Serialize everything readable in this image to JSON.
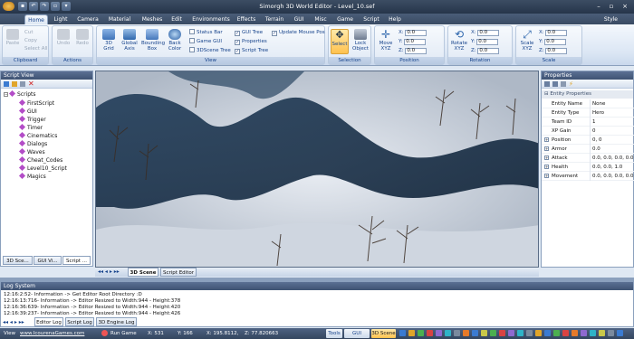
{
  "window": {
    "title": "Simorgh 3D World Editor - Level_10.sef",
    "style_label": "Style"
  },
  "tabs": [
    "Home",
    "Light",
    "Camera",
    "Material",
    "Meshes",
    "Edit",
    "Environments",
    "Effects",
    "Terrain",
    "GUI",
    "Misc",
    "Game",
    "Script",
    "Help"
  ],
  "ribbon": {
    "clipboard": {
      "label": "Clipboard",
      "paste": "Paste",
      "cut": "Cut",
      "copy": "Copy",
      "select_all": "Select All"
    },
    "actions": {
      "label": "Actions",
      "undo": "Undo",
      "redo": "Redo"
    },
    "view": {
      "label": "View",
      "grid": "3D Grid",
      "global_axis": "Global Axis",
      "bounding_box": "Bounding Box",
      "back_color": "Back Color",
      "checks": [
        {
          "label": "Status Bar",
          "checked": false
        },
        {
          "label": "Game GUI",
          "checked": false
        },
        {
          "label": "3DScene Tree",
          "checked": false
        },
        {
          "label": "GUI Tree",
          "checked": true
        },
        {
          "label": "Properties",
          "checked": true
        },
        {
          "label": "Script Tree",
          "checked": true
        },
        {
          "label": "Update Mouse Pos",
          "checked": true
        }
      ]
    },
    "selection": {
      "label": "Selection",
      "select": "Select",
      "lock_object": "Lock Object"
    },
    "position": {
      "label": "Position",
      "move": "Move XYZ",
      "x": "0.0",
      "y": "0.0",
      "z": "0.0"
    },
    "rotation": {
      "label": "Rotation",
      "rotate": "Rotate XYZ",
      "x": "0.0",
      "y": "0.0",
      "z": "0.0"
    },
    "scale": {
      "label": "Scale",
      "scale": "Scale XYZ",
      "x": "0.0",
      "y": "0.0",
      "z": "0.0"
    }
  },
  "script_view": {
    "title": "Script View",
    "root": "Scripts",
    "items": [
      "FirstScript",
      "GUI",
      "Trigger",
      "Timer",
      "Cinematics",
      "Dialogs",
      "Waves",
      "Cheat_Codes",
      "Level10_Script",
      "Magics"
    ],
    "bottom_tabs": [
      "3D Sce...",
      "GUI Vi...",
      "Script ..."
    ]
  },
  "viewport": {
    "tabs": [
      "3D Scene",
      "Script Editor"
    ]
  },
  "properties": {
    "title": "Properties",
    "section": "Entity Properties",
    "rows": [
      {
        "k": "Entity Name",
        "v": "None",
        "exp": false
      },
      {
        "k": "Entity Type",
        "v": "Hero",
        "exp": false
      },
      {
        "k": "Team ID",
        "v": "1",
        "exp": false
      },
      {
        "k": "XP Gain",
        "v": "0",
        "exp": false
      },
      {
        "k": "Position",
        "v": "0, 0",
        "exp": true
      },
      {
        "k": "Armor",
        "v": "0.0",
        "exp": true
      },
      {
        "k": "Attack",
        "v": "0.0, 0.0, 0.0, 0.0",
        "exp": true
      },
      {
        "k": "Health",
        "v": "0.0, 0.0, 1.0",
        "exp": true
      },
      {
        "k": "Movement",
        "v": "0.0, 0.0, 0.0, 0.0",
        "exp": true
      }
    ]
  },
  "log": {
    "title": "Log System",
    "lines": [
      "12:16:2:52- Information  -> Get Editor Root Directory :D",
      "12:16:13:716- Information  -> Editor Resized to Width:944 - Height:378",
      "12:16:36:639- Information  -> Editor Resized to Width:944 - Height:420",
      "12:16:39:237- Information  -> Editor Resized to Width:944 - Height:426"
    ],
    "tabs": [
      "Editor Log",
      "Script Log",
      "3D Engine Log"
    ]
  },
  "status": {
    "view": "View",
    "url": "www.IcourenaGames.com",
    "run_game": "Run Game",
    "x": "X: 531",
    "y": "Y: 166",
    "wx": "X: 195.8112,",
    "wz": "Z: 77.820663",
    "tools": "Tools",
    "gui_scene": "GUI Scene",
    "scene3d": "3D Scene"
  }
}
